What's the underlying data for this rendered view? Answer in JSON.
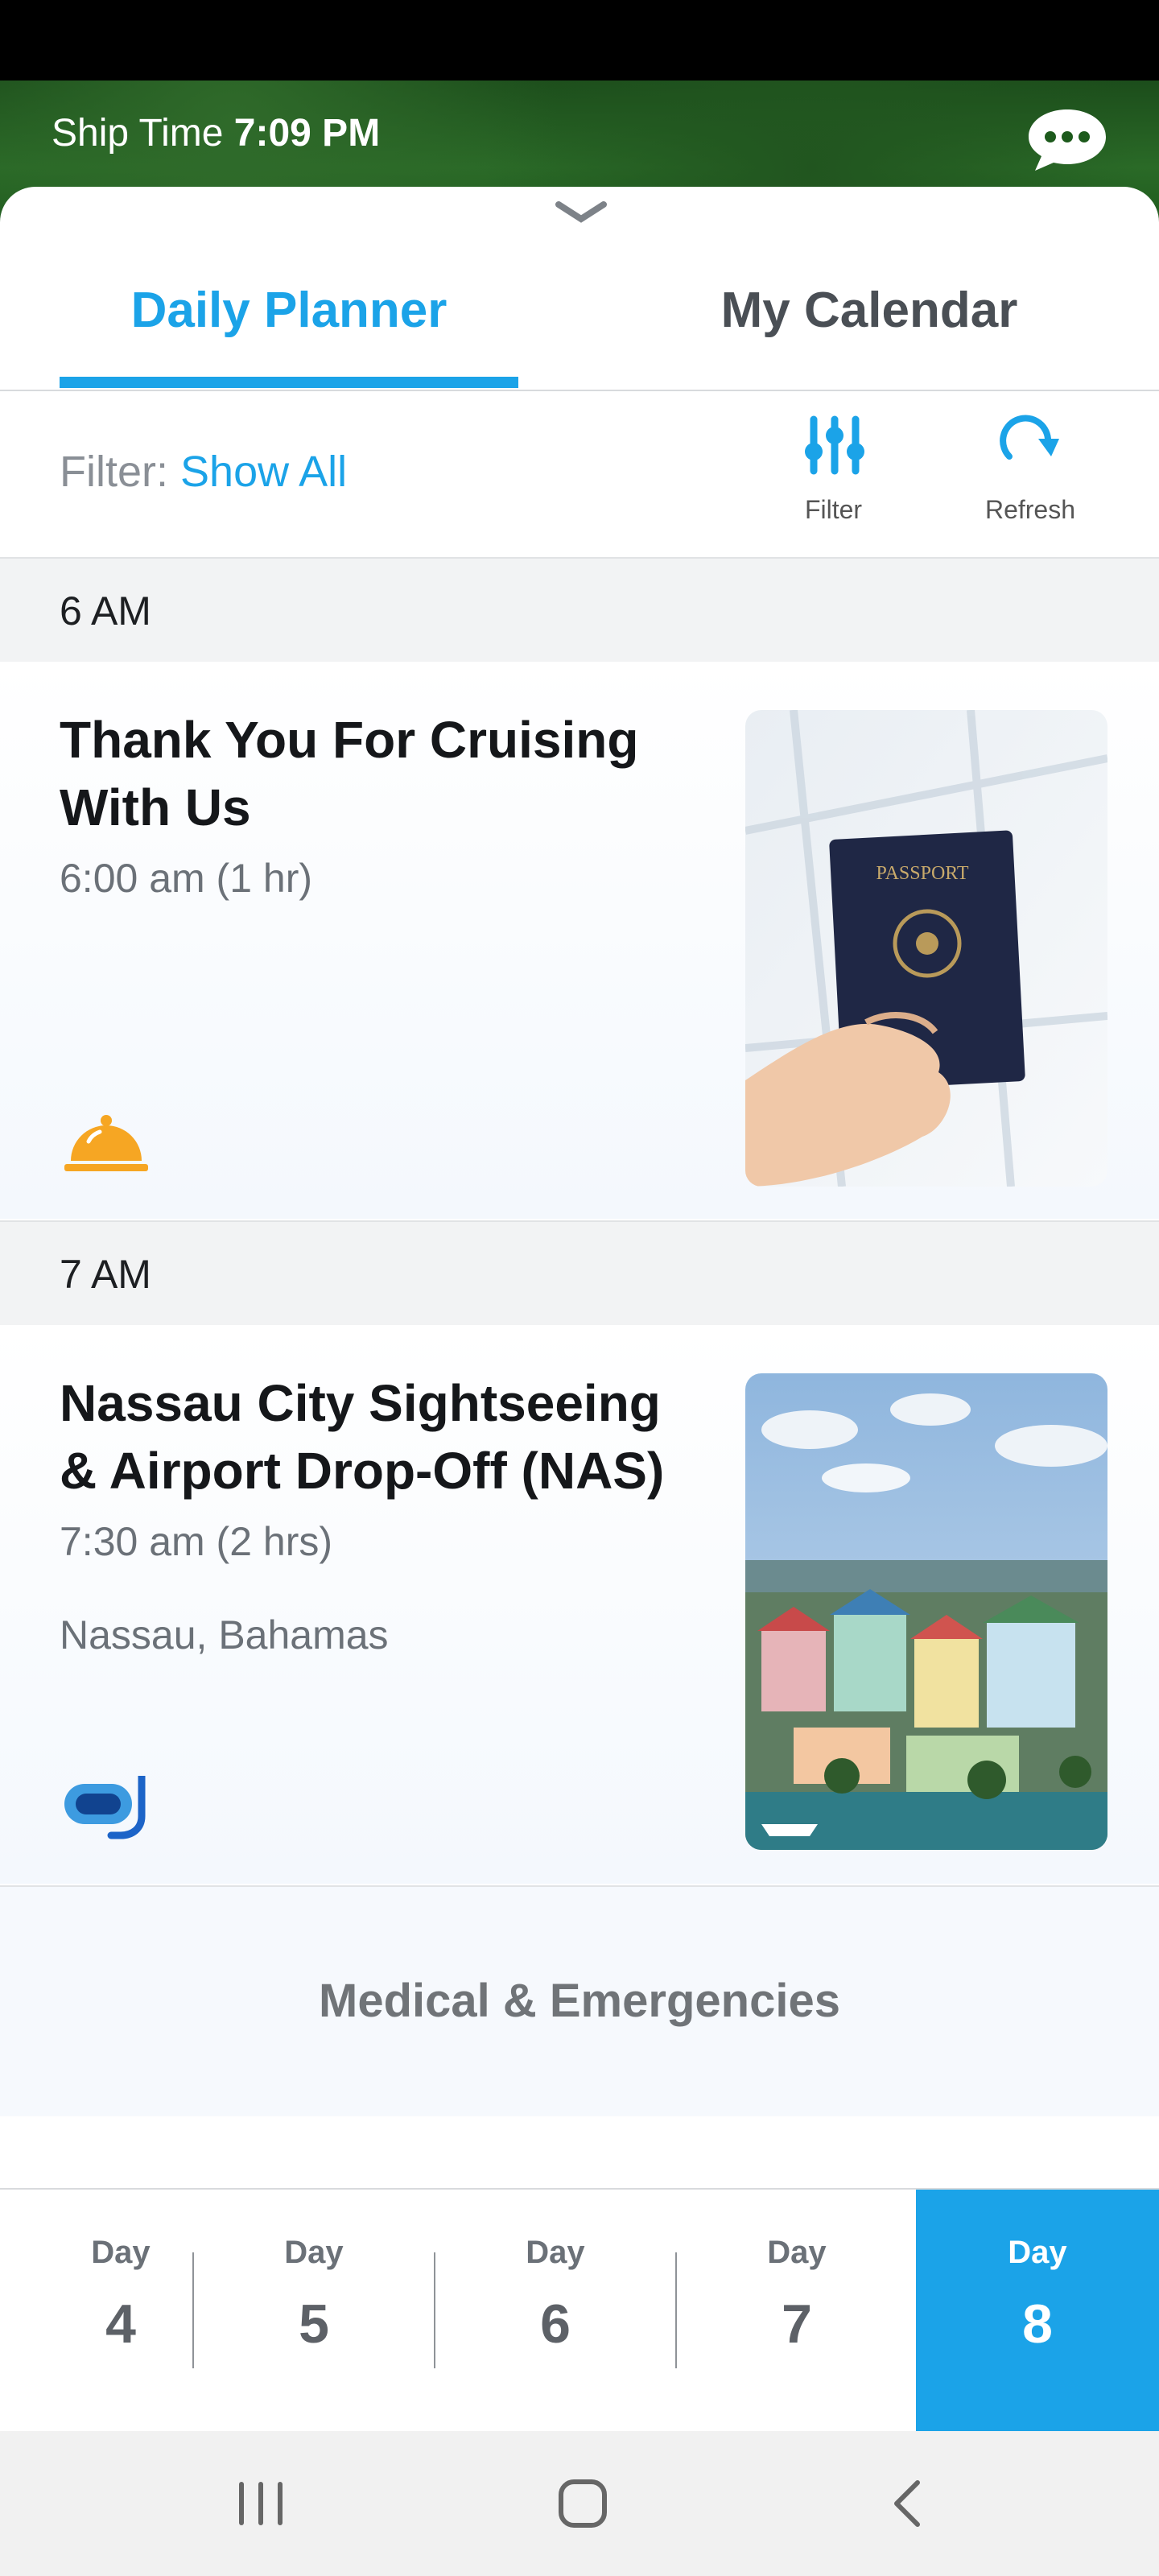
{
  "header": {
    "ship_time_label": "Ship Time",
    "ship_time_value": "7:09 PM",
    "chat_icon": "chat-bubble-icon"
  },
  "tabs": [
    {
      "label": "Daily Planner",
      "active": true
    },
    {
      "label": "My Calendar",
      "active": false
    }
  ],
  "filter": {
    "label": "Filter:",
    "value": "Show All",
    "filter_button_label": "Filter",
    "refresh_button_label": "Refresh"
  },
  "schedule": [
    {
      "hour": "6 AM",
      "event": {
        "title": "Thank You For Cruising With Us",
        "time": "6:00 am (1 hr)",
        "location": "",
        "category_icon": "service-bell-icon",
        "image": "passport-photo"
      }
    },
    {
      "hour": "7 AM",
      "event": {
        "title": "Nassau City Sightseeing & Airport Drop-Off (NAS)",
        "time": "7:30 am (2 hrs)",
        "location": "Nassau, Bahamas",
        "category_icon": "snorkel-mask-icon",
        "image": "nassau-town-photo"
      }
    }
  ],
  "medical_label": "Medical & Emergencies",
  "days": [
    {
      "word": "Day",
      "num": "4",
      "active": false
    },
    {
      "word": "Day",
      "num": "5",
      "active": false
    },
    {
      "word": "Day",
      "num": "6",
      "active": false
    },
    {
      "word": "Day",
      "num": "7",
      "active": false
    },
    {
      "word": "Day",
      "num": "8",
      "active": true
    }
  ],
  "colors": {
    "accent": "#1ba3e8",
    "bell": "#f6a623",
    "header_green": "#2a6a27"
  }
}
